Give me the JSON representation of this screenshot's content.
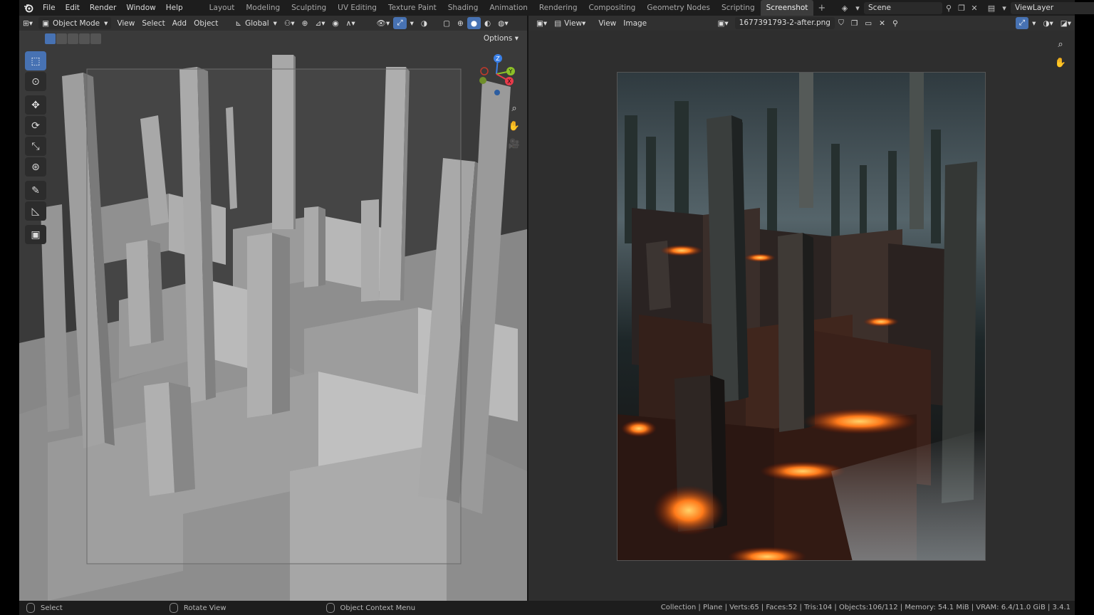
{
  "top_menu": {
    "items": [
      "File",
      "Edit",
      "Render",
      "Window",
      "Help"
    ]
  },
  "workspaces": {
    "tabs": [
      "Layout",
      "Modeling",
      "Sculpting",
      "UV Editing",
      "Texture Paint",
      "Shading",
      "Animation",
      "Rendering",
      "Compositing",
      "Geometry Nodes",
      "Scripting",
      "Screenshot"
    ],
    "active": "Screenshot"
  },
  "scene": {
    "name": "Scene",
    "view_layer": "ViewLayer"
  },
  "viewport": {
    "mode": "Object Mode",
    "menus": [
      "View",
      "Select",
      "Add",
      "Object"
    ],
    "orientation": "Global",
    "options_label": "Options",
    "tools": [
      "select-box",
      "cursor",
      "move",
      "rotate",
      "scale",
      "transform",
      "annotate",
      "measure",
      "add-cube"
    ],
    "gizmo_axes": {
      "z": "Z",
      "y": "Y",
      "x": "X"
    }
  },
  "image_editor": {
    "menus": [
      "View",
      "View",
      "Image"
    ],
    "image_name": "1677391793-2-after.png"
  },
  "statusbar": {
    "select": "Select",
    "rotate_view": "Rotate View",
    "context_menu": "Object Context Menu",
    "stats": "Collection | Plane | Verts:65 | Faces:52 | Tris:104 | Objects:106/112 | Memory: 54.1 MiB | VRAM: 6.4/11.0 GiB | 3.4.1"
  },
  "colors": {
    "accent": "#4772b3",
    "axis_x": "#e83a4a",
    "axis_y": "#8cbf28",
    "axis_z": "#3a80e8"
  }
}
